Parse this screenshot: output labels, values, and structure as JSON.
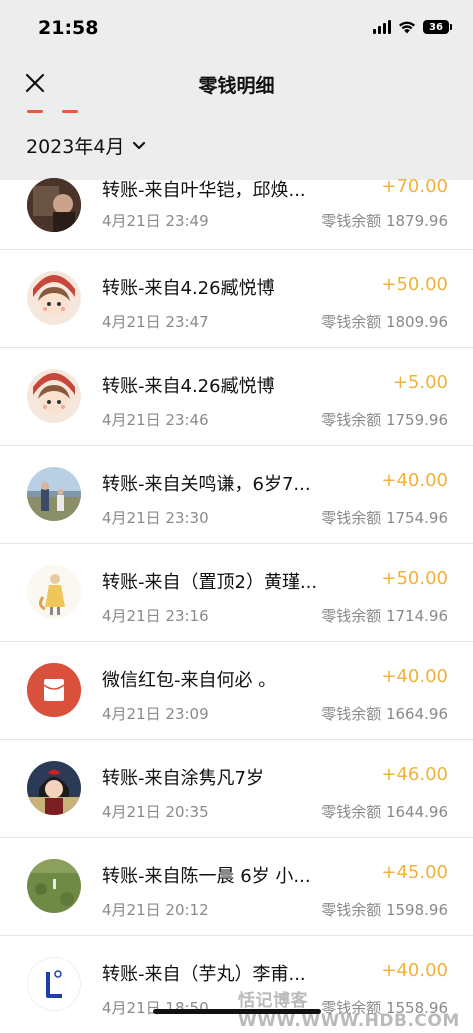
{
  "status_bar": {
    "time": "21:58",
    "battery": "36"
  },
  "nav": {
    "title": "零钱明细"
  },
  "filter": {
    "month": "2023年4月"
  },
  "transactions": [
    {
      "title": "转账-来自叶华铠，邱焕...",
      "amount": "+70.00",
      "date": "4月21日 23:49",
      "balance": "零钱余额 1879.96",
      "avatar": "photo-avatar"
    },
    {
      "title": "转账-来自4.26臧悦博",
      "amount": "+50.00",
      "date": "4月21日 23:47",
      "balance": "零钱余额 1809.96",
      "avatar": "cartoon-girl-avatar"
    },
    {
      "title": "转账-来自4.26臧悦博",
      "amount": "+5.00",
      "date": "4月21日 23:46",
      "balance": "零钱余额 1759.96",
      "avatar": "cartoon-girl-avatar"
    },
    {
      "title": "转账-来自关鸣谦，6岁7...",
      "amount": "+40.00",
      "date": "4月21日 23:30",
      "balance": "零钱余额 1754.96",
      "avatar": "outdoor-photo-avatar"
    },
    {
      "title": "转账-来自（置顶2）黄瑾...",
      "amount": "+50.00",
      "date": "4月21日 23:16",
      "balance": "零钱余额 1714.96",
      "avatar": "illustration-avatar"
    },
    {
      "title": "微信红包-来自何必 。",
      "amount": "+40.00",
      "date": "4月21日 23:09",
      "balance": "零钱余额 1664.96",
      "avatar": "red-packet-icon"
    },
    {
      "title": "转账-来自涂隽凡7岁",
      "amount": "+46.00",
      "date": "4月21日 20:35",
      "balance": "零钱余额 1644.96",
      "avatar": "anime-avatar"
    },
    {
      "title": "转账-来自陈一晨 6岁 小...",
      "amount": "+45.00",
      "date": "4月21日 20:12",
      "balance": "零钱余额 1598.96",
      "avatar": "grass-photo-avatar"
    },
    {
      "title": "转账-来自（芋丸）李甫...",
      "amount": "+40.00",
      "date": "4月21日 18:50",
      "balance": "零钱余额 1558.96",
      "avatar": "letter-l-avatar"
    }
  ],
  "watermark": "恬记博客 WWW.WWW.HDB.COM",
  "colors": {
    "header_bg": "#ededed",
    "amount": "#f0b23a",
    "red_packet": "#d9503d",
    "secondary_text": "#8a8a8a"
  }
}
